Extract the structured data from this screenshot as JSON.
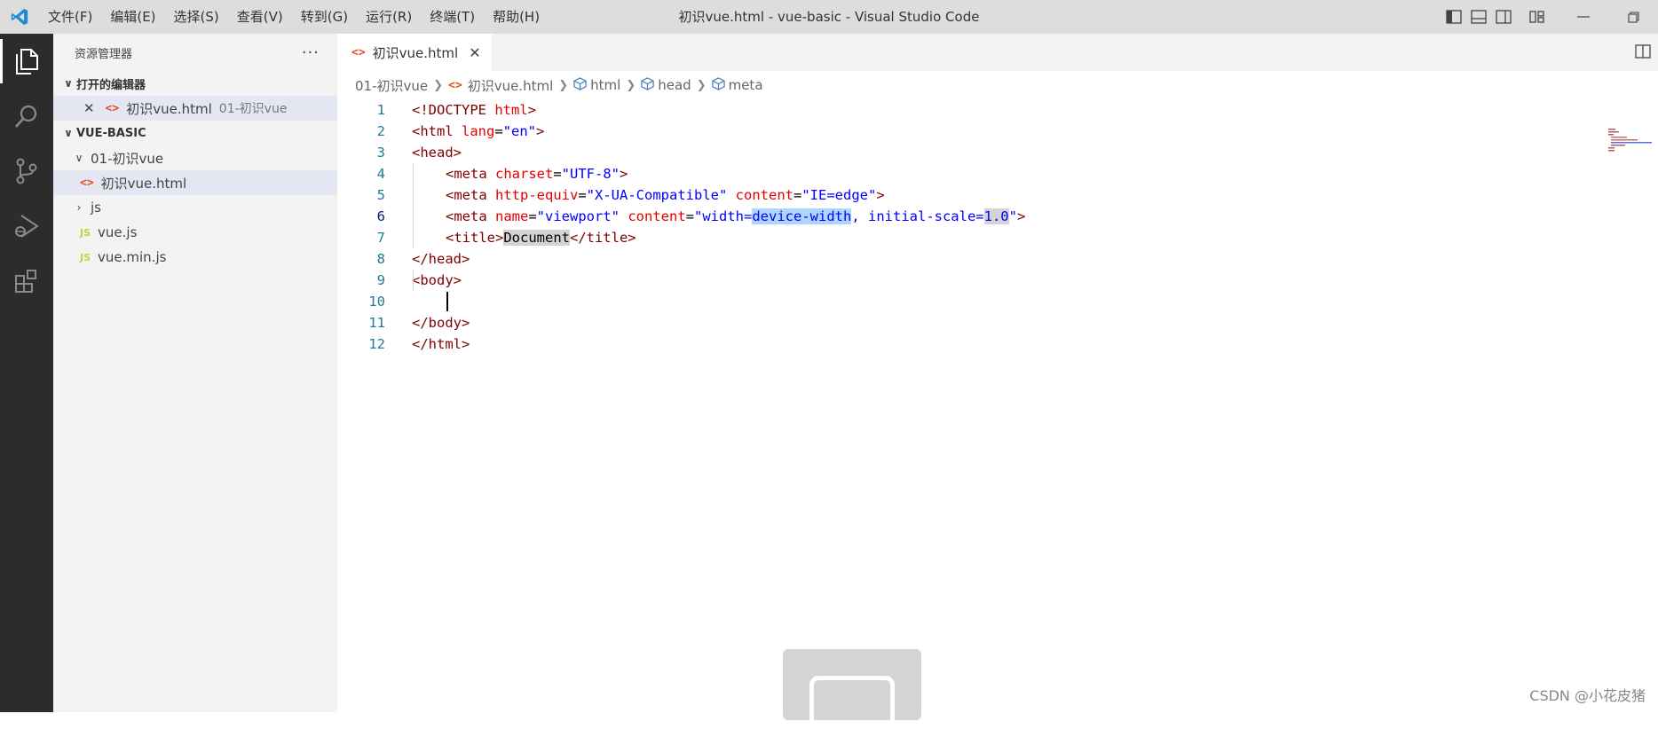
{
  "titlebar": {
    "menu": [
      "文件(F)",
      "编辑(E)",
      "选择(S)",
      "查看(V)",
      "转到(G)",
      "运行(R)",
      "终端(T)",
      "帮助(H)"
    ],
    "title": "初识vue.html - vue-basic - Visual Studio Code"
  },
  "sidebar": {
    "title": "资源管理器",
    "more": "···",
    "open_editors_label": "打开的编辑器",
    "open_editor_file": "初识vue.html",
    "open_editor_dir": "01-初识vue",
    "workspace_label": "VUE-BASIC",
    "tree": {
      "folder1": "01-初识vue",
      "folder1_file": "初识vue.html",
      "folder2": "js",
      "js_file1": "vue.js",
      "js_file2": "vue.min.js",
      "js_badge": "JS"
    }
  },
  "editor": {
    "tab_label": "初识vue.html",
    "breadcrumb": [
      "01-初识vue",
      "初识vue.html",
      "html",
      "head",
      "meta"
    ],
    "line_numbers": [
      "1",
      "2",
      "3",
      "4",
      "5",
      "6",
      "7",
      "8",
      "9",
      "10",
      "11",
      "12"
    ],
    "code": {
      "l1_a": "<!DOCTYPE ",
      "l1_b": "html",
      "l1_c": ">",
      "l2_a": "<html ",
      "l2_b": "lang",
      "l2_c": "=",
      "l2_d": "\"en\"",
      "l2_e": ">",
      "l3": "<head>",
      "l4_a": "<meta ",
      "l4_b": "charset",
      "l4_c": "=",
      "l4_d": "\"UTF-8\"",
      "l4_e": ">",
      "l5_a": "<meta ",
      "l5_b": "http-equiv",
      "l5_c": "=",
      "l5_d": "\"X-UA-Compatible\"",
      "l5_e": " ",
      "l5_f": "content",
      "l5_g": "=",
      "l5_h": "\"IE=edge\"",
      "l5_i": ">",
      "l6_a": "<meta ",
      "l6_b": "name",
      "l6_c": "=",
      "l6_d": "\"viewport\"",
      "l6_e": " ",
      "l6_f": "content",
      "l6_g": "=",
      "l6_h": "\"width=",
      "l6_i": "device-width",
      "l6_j": ", initial-scale=",
      "l6_k": "1.0",
      "l6_l": "\"",
      "l6_m": ">",
      "l7_a": "<title>",
      "l7_b": "Document",
      "l7_c": "</title>",
      "l8": "</head>",
      "l9": "<body>",
      "l11": "</body>",
      "l12": "</html>"
    }
  },
  "watermark": "CSDN @小花皮猪",
  "colors": {
    "activity_bar": "#2c2c2c",
    "sidebar": "#f3f3f3",
    "titlebar": "#dddddd",
    "selection": "#add6ff",
    "tag": "#800000",
    "attribute": "#e50000",
    "string": "#0000ff"
  }
}
